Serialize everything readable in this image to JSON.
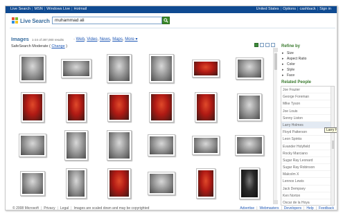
{
  "topbar": {
    "left_links": [
      "Live Search",
      "MSN",
      "Windows Live",
      "Hotmail"
    ],
    "right_links": [
      "United States",
      "Options",
      "cashback",
      "Sign in"
    ]
  },
  "logo": {
    "text": "Live Search"
  },
  "search": {
    "query": "muhammad ali"
  },
  "header": {
    "vertical": "Images",
    "results": "1-24 of 287,000 results",
    "links": [
      "Web",
      "Video",
      "News",
      "Maps",
      "More ▾"
    ],
    "safesearch": "SafeSearch Moderate",
    "change": "Change"
  },
  "refine": {
    "title": "Refine by",
    "items": [
      "Size",
      "Aspect Ratio",
      "Color",
      "Style",
      "Face"
    ]
  },
  "related": {
    "title": "Related People",
    "items": [
      "Joe Frazier",
      "George Foreman",
      "Mike Tyson",
      "Joe Louis",
      "Sonny Liston",
      "Larry Holmes",
      "Floyd Patterson",
      "Leon Spinks",
      "Evander Holyfield",
      "Rocky Marciano",
      "Sugar Ray Leonard",
      "Sugar Ray Robinson",
      "Malcolm X",
      "Lennox Lewis",
      "Jack Dempsey",
      "Ken Norton",
      "Oscar de la Hoya",
      "Don King"
    ],
    "highlighted": "Larry Holmes",
    "tooltip": "Larry Ho"
  },
  "footer": {
    "left": [
      "© 2008 Microsoft",
      "Privacy",
      "Legal",
      "Images are scaled down and may be copyrighted"
    ],
    "right": [
      "Advertise",
      "Webmasters",
      "Developers",
      "Help",
      "Feedback"
    ]
  },
  "colors": {
    "topbar": "#0f4a91",
    "accent_green": "#3a7a2e",
    "link": "#1c56b5"
  },
  "thumbnails": [
    {
      "tone": "bw"
    },
    {
      "tone": "bw"
    },
    {
      "tone": "bw"
    },
    {
      "tone": "bw"
    },
    {
      "tone": "red"
    },
    {
      "tone": "bw"
    },
    {
      "tone": "red"
    },
    {
      "tone": "red"
    },
    {
      "tone": "red"
    },
    {
      "tone": "red"
    },
    {
      "tone": "red"
    },
    {
      "tone": "bw"
    },
    {
      "tone": "bw"
    },
    {
      "tone": "bw"
    },
    {
      "tone": "bw"
    },
    {
      "tone": "bw"
    },
    {
      "tone": "bw"
    },
    {
      "tone": "bw"
    },
    {
      "tone": "bw"
    },
    {
      "tone": "bw"
    },
    {
      "tone": "red"
    },
    {
      "tone": "bw"
    },
    {
      "tone": "red"
    },
    {
      "tone": "dark"
    }
  ]
}
